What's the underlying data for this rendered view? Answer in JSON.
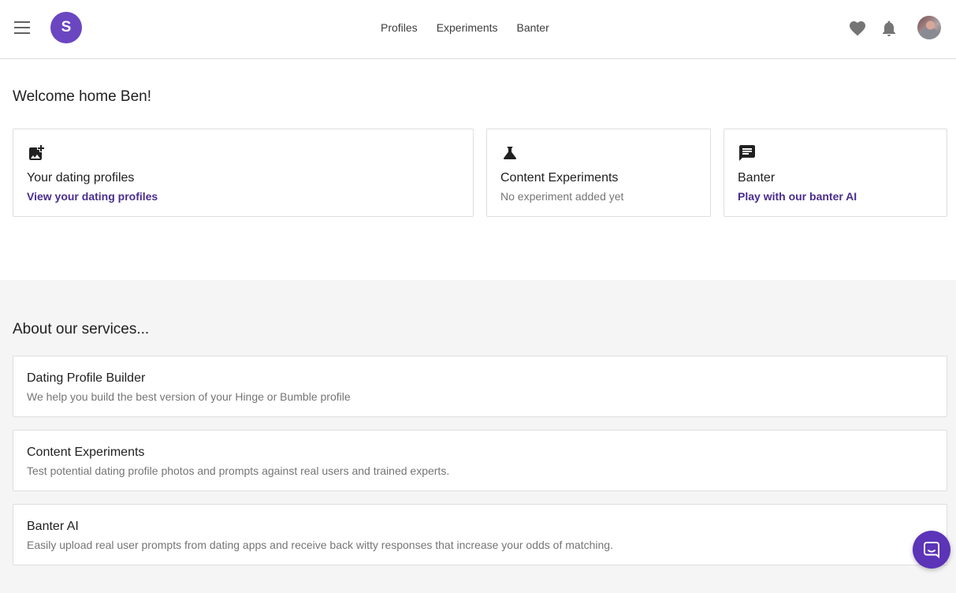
{
  "header": {
    "logo_letter": "S",
    "nav": [
      "Profiles",
      "Experiments",
      "Banter"
    ]
  },
  "home": {
    "welcome": "Welcome home Ben!",
    "cards": [
      {
        "icon": "add-photo-icon",
        "title": "Your dating profiles",
        "subtitle": "View your dating profiles"
      },
      {
        "icon": "flask-icon",
        "title": "Content Experiments",
        "subtitle": "No experiment added yet"
      },
      {
        "icon": "chat-icon",
        "title": "Banter",
        "subtitle": "Play with our banter AI"
      }
    ]
  },
  "about": {
    "title": "About our services...",
    "services": [
      {
        "title": "Dating Profile Builder",
        "description": "We help you build the best version of your Hinge or Bumble profile"
      },
      {
        "title": "Content Experiments",
        "description": "Test potential dating profile photos and prompts against real users and trained experts."
      },
      {
        "title": "Banter AI",
        "description": "Easily upload real user prompts from dating apps and receive back witty responses that increase your odds of matching."
      }
    ]
  },
  "colors": {
    "brand": "#6b46c1",
    "link": "#4a2d8f",
    "section_bg": "#f5f5f5"
  }
}
